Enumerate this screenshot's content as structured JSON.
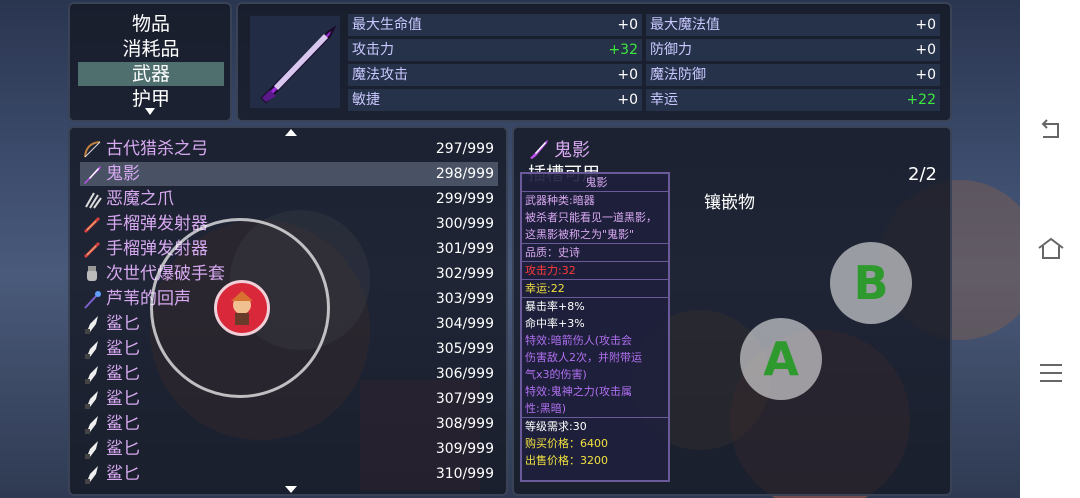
{
  "categories": [
    {
      "label": "物品",
      "selected": false
    },
    {
      "label": "消耗品",
      "selected": false
    },
    {
      "label": "武器",
      "selected": true
    },
    {
      "label": "护甲",
      "selected": false
    }
  ],
  "stats": [
    {
      "label": "最大生命值",
      "value": "+0"
    },
    {
      "label": "最大魔法值",
      "value": "+0"
    },
    {
      "label": "攻击力",
      "value": "+32"
    },
    {
      "label": "防御力",
      "value": "+0"
    },
    {
      "label": "魔法攻击",
      "value": "+0"
    },
    {
      "label": "魔法防御",
      "value": "+0"
    },
    {
      "label": "敏捷",
      "value": "+0"
    },
    {
      "label": "幸运",
      "value": "+22"
    }
  ],
  "items": [
    {
      "name": "古代猎杀之弓",
      "count": "297/999",
      "icon": "bow-icon"
    },
    {
      "name": "鬼影",
      "count": "298/999",
      "icon": "dagger-icon"
    },
    {
      "name": "恶魔之爪",
      "count": "299/999",
      "icon": "claw-icon"
    },
    {
      "name": "手榴弹发射器",
      "count": "300/999",
      "icon": "launcher-icon"
    },
    {
      "name": "手榴弹发射器",
      "count": "301/999",
      "icon": "launcher-icon"
    },
    {
      "name": "次世代爆破手套",
      "count": "302/999",
      "icon": "glove-icon"
    },
    {
      "name": "芦苇的回声",
      "count": "303/999",
      "icon": "staff-icon"
    },
    {
      "name": "鲨匕",
      "count": "304/999",
      "icon": "shark-dagger-icon"
    },
    {
      "name": "鲨匕",
      "count": "305/999",
      "icon": "shark-dagger-icon"
    },
    {
      "name": "鲨匕",
      "count": "306/999",
      "icon": "shark-dagger-icon"
    },
    {
      "name": "鲨匕",
      "count": "307/999",
      "icon": "shark-dagger-icon"
    },
    {
      "name": "鲨匕",
      "count": "308/999",
      "icon": "shark-dagger-icon"
    },
    {
      "name": "鲨匕",
      "count": "309/999",
      "icon": "shark-dagger-icon"
    },
    {
      "name": "鲨匕",
      "count": "310/999",
      "icon": "shark-dagger-icon"
    }
  ],
  "selected_index": 1,
  "detail": {
    "name": "鬼影",
    "socket_label": "插槽可用",
    "page": "2/2",
    "inlay_label": "镶嵌物"
  },
  "tooltip": {
    "title": "鬼影",
    "type": "武器种类:暗器",
    "desc1": "被杀者只能看见一道黑影，",
    "desc2": "这黑影被称之为\"鬼影\"",
    "quality": "品质：史诗",
    "attack": "攻击力:32",
    "luck": "幸运:22",
    "crit": "暴击率+8%",
    "hit": "命中率+3%",
    "effect1a": "特效:暗箭伤人(攻击会",
    "effect1b": "伤害敌人2次，并附带运",
    "effect1c": "气x3的伤害)",
    "effect2a": "特效:鬼神之力(攻击属",
    "effect2b": "性:黑暗)",
    "level": "等级需求:30",
    "buy": "购买价格：6400",
    "sell": "出售价格：3200"
  },
  "buttons": {
    "a": "A",
    "b": "B"
  },
  "colors": {
    "accent_green": "#3ce83c",
    "item_purple": "#d7a9f0",
    "tooltip_border": "#6a5a9a"
  }
}
